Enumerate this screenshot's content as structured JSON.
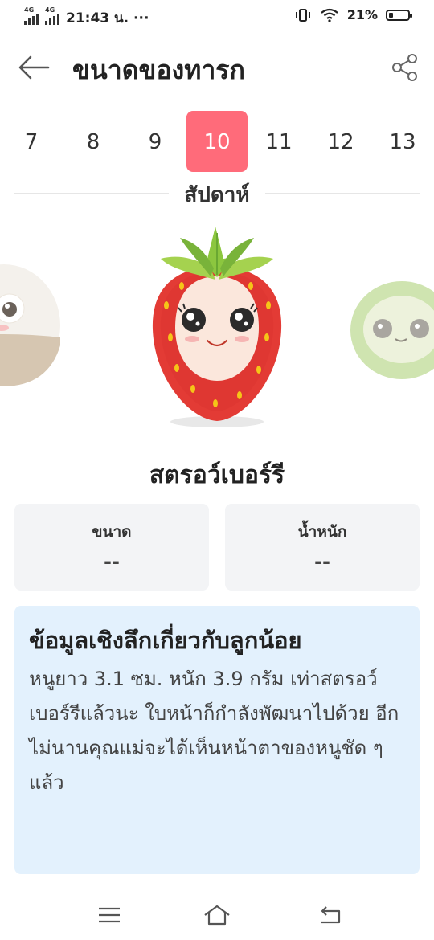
{
  "status_bar": {
    "network_1": "4G",
    "network_2": "4G",
    "time": "21:43 น. ···",
    "battery": "21%"
  },
  "header": {
    "title": "ขนาดของทารก"
  },
  "weeks": {
    "items": [
      "7",
      "8",
      "9",
      "10",
      "11",
      "12",
      "13"
    ],
    "selected": "10",
    "unit": "สัปดาห์"
  },
  "fruit": {
    "name": "สตรอว์เบอร์รี"
  },
  "stats": {
    "size_label": "ขนาด",
    "size_value": "--",
    "weight_label": "น้ำหนัก",
    "weight_value": "--"
  },
  "insight": {
    "title": "ข้อมูลเชิงลึกเกี่ยวกับลูกน้อย",
    "body": "หนูยาว 3.1 ซม. หนัก 3.9 กรัม เท่าสตรอว์เบอร์รีแล้วนะ ใบหน้าก็กำลังพัฒนาไปด้วย อีกไม่นานคุณแม่จะได้เห็นหน้าตาของหนูชัด ๆ แล้ว"
  },
  "colors": {
    "accent": "#ff6b7a",
    "card_bg": "#f3f4f6",
    "insight_bg": "#e3f1fd"
  },
  "icons": {
    "back": "arrow-left-icon",
    "share": "share-icon",
    "nav_menu": "menu-icon",
    "nav_home": "home-icon",
    "nav_back": "return-icon"
  }
}
